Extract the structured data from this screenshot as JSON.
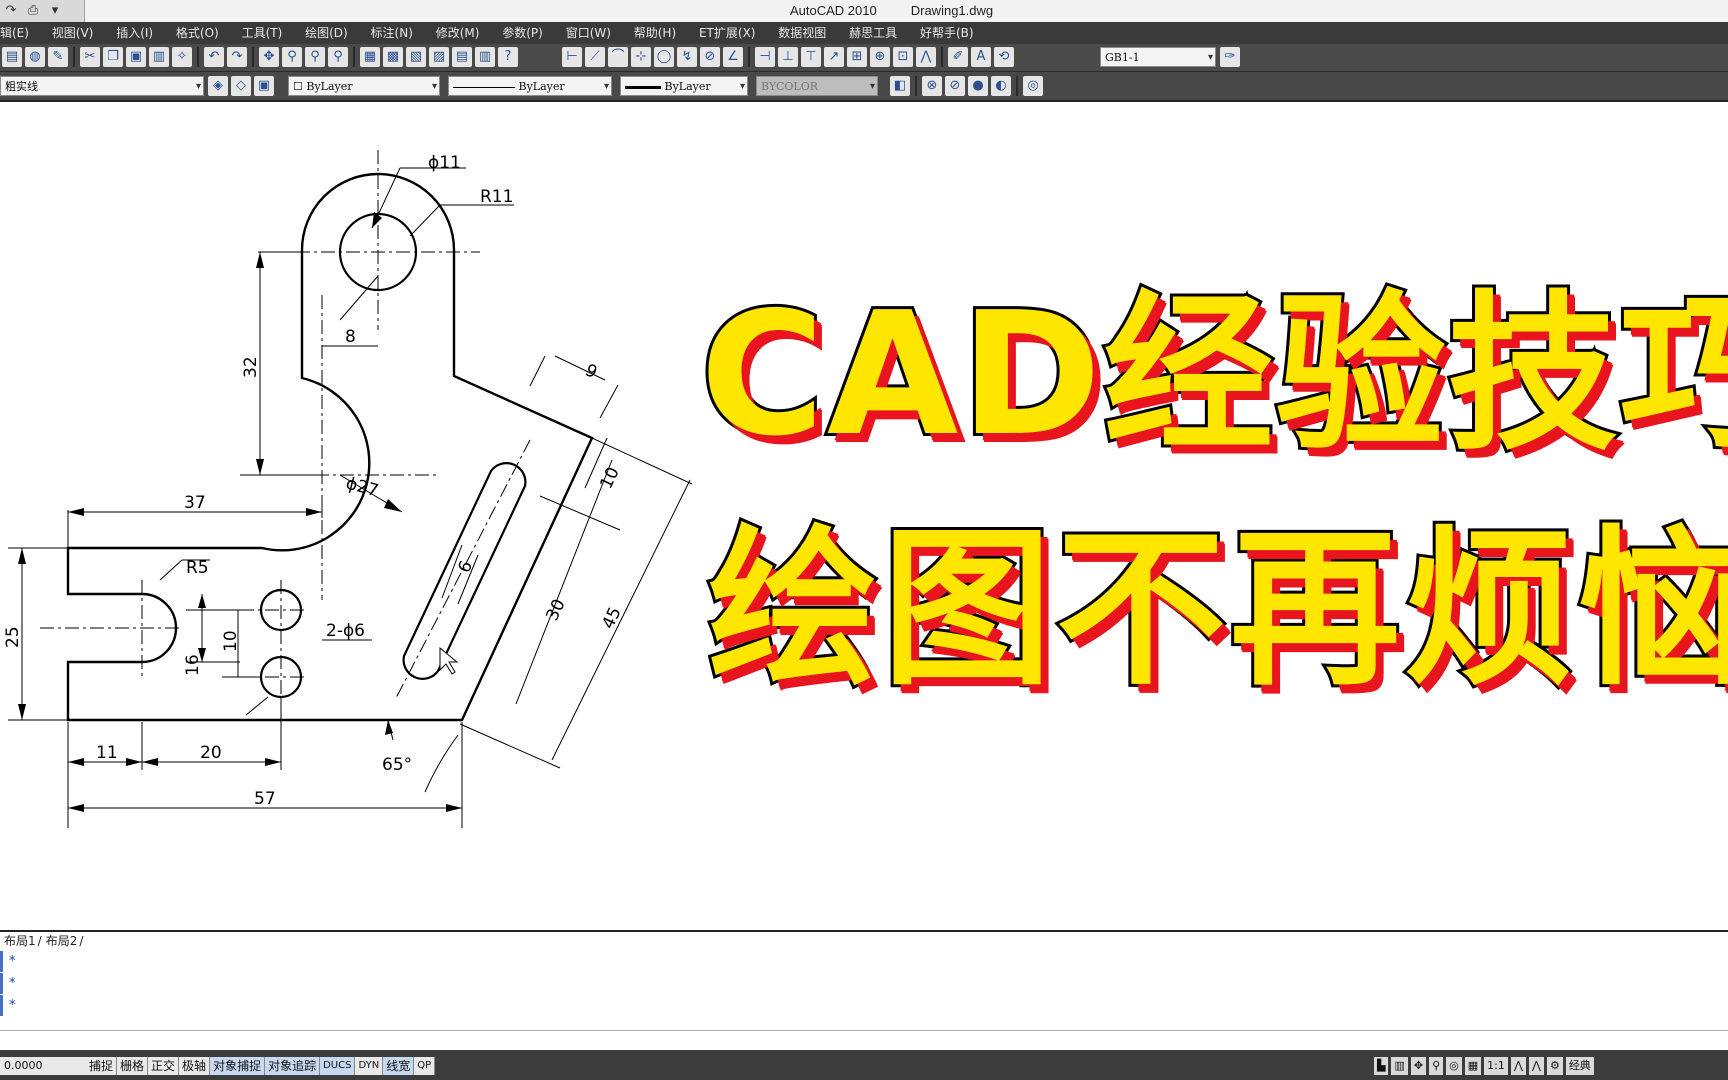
{
  "window": {
    "app": "AutoCAD 2010",
    "file": "Drawing1.dwg"
  },
  "quick_access": {
    "redo_icon": "redo-arrow",
    "print_icon": "printer",
    "dropdown_icon": "triangle-down"
  },
  "menu": [
    "辑(E)",
    "视图(V)",
    "插入(I)",
    "格式(O)",
    "工具(T)",
    "绘图(D)",
    "标注(N)",
    "修改(M)",
    "参数(P)",
    "窗口(W)",
    "帮助(H)",
    "ET扩展(X)",
    "数据视图",
    "赫思工具",
    "好帮手(B)"
  ],
  "toolbar1": {
    "dimstyle": "GB1-1"
  },
  "toolbar2": {
    "layer": "粗实线",
    "color": "ByLayer",
    "linetype": "ByLayer",
    "lineweight": "ByLayer",
    "plotstyle": "BYCOLOR"
  },
  "drawing": {
    "dims": {
      "d_hole": "ϕ11",
      "r_top": "R11",
      "offset8": "8",
      "height32": "32",
      "d_arc": "ϕ27",
      "len37": "37",
      "r_slot": "R5",
      "h25": "25",
      "h16": "16",
      "h10": "10",
      "holes": "2-ϕ6",
      "w11": "11",
      "w20": "20",
      "w57": "57",
      "angle": "65°",
      "s9": "9",
      "s10": "10",
      "s6": "6",
      "s30": "30",
      "s45": "45"
    }
  },
  "overlay": {
    "line1": "CAD经验技巧",
    "line2": "绘图不再烦恼"
  },
  "layout_tabs": [
    "布局1",
    "布局2"
  ],
  "command_lines": [
    "*",
    "*",
    "*"
  ],
  "status": {
    "coords": "0.0000",
    "modes": [
      {
        "label": "捕捉",
        "on": false
      },
      {
        "label": "栅格",
        "on": false
      },
      {
        "label": "正交",
        "on": false
      },
      {
        "label": "极轴",
        "on": false
      },
      {
        "label": "对象捕捉",
        "on": true
      },
      {
        "label": "对象追踪",
        "on": true
      },
      {
        "label": "DUCS",
        "on": true
      },
      {
        "label": "DYN",
        "on": false
      },
      {
        "label": "线宽",
        "on": true
      },
      {
        "label": "QP",
        "on": false
      }
    ],
    "annotation_scale": "1:1",
    "workspace": "经典"
  }
}
